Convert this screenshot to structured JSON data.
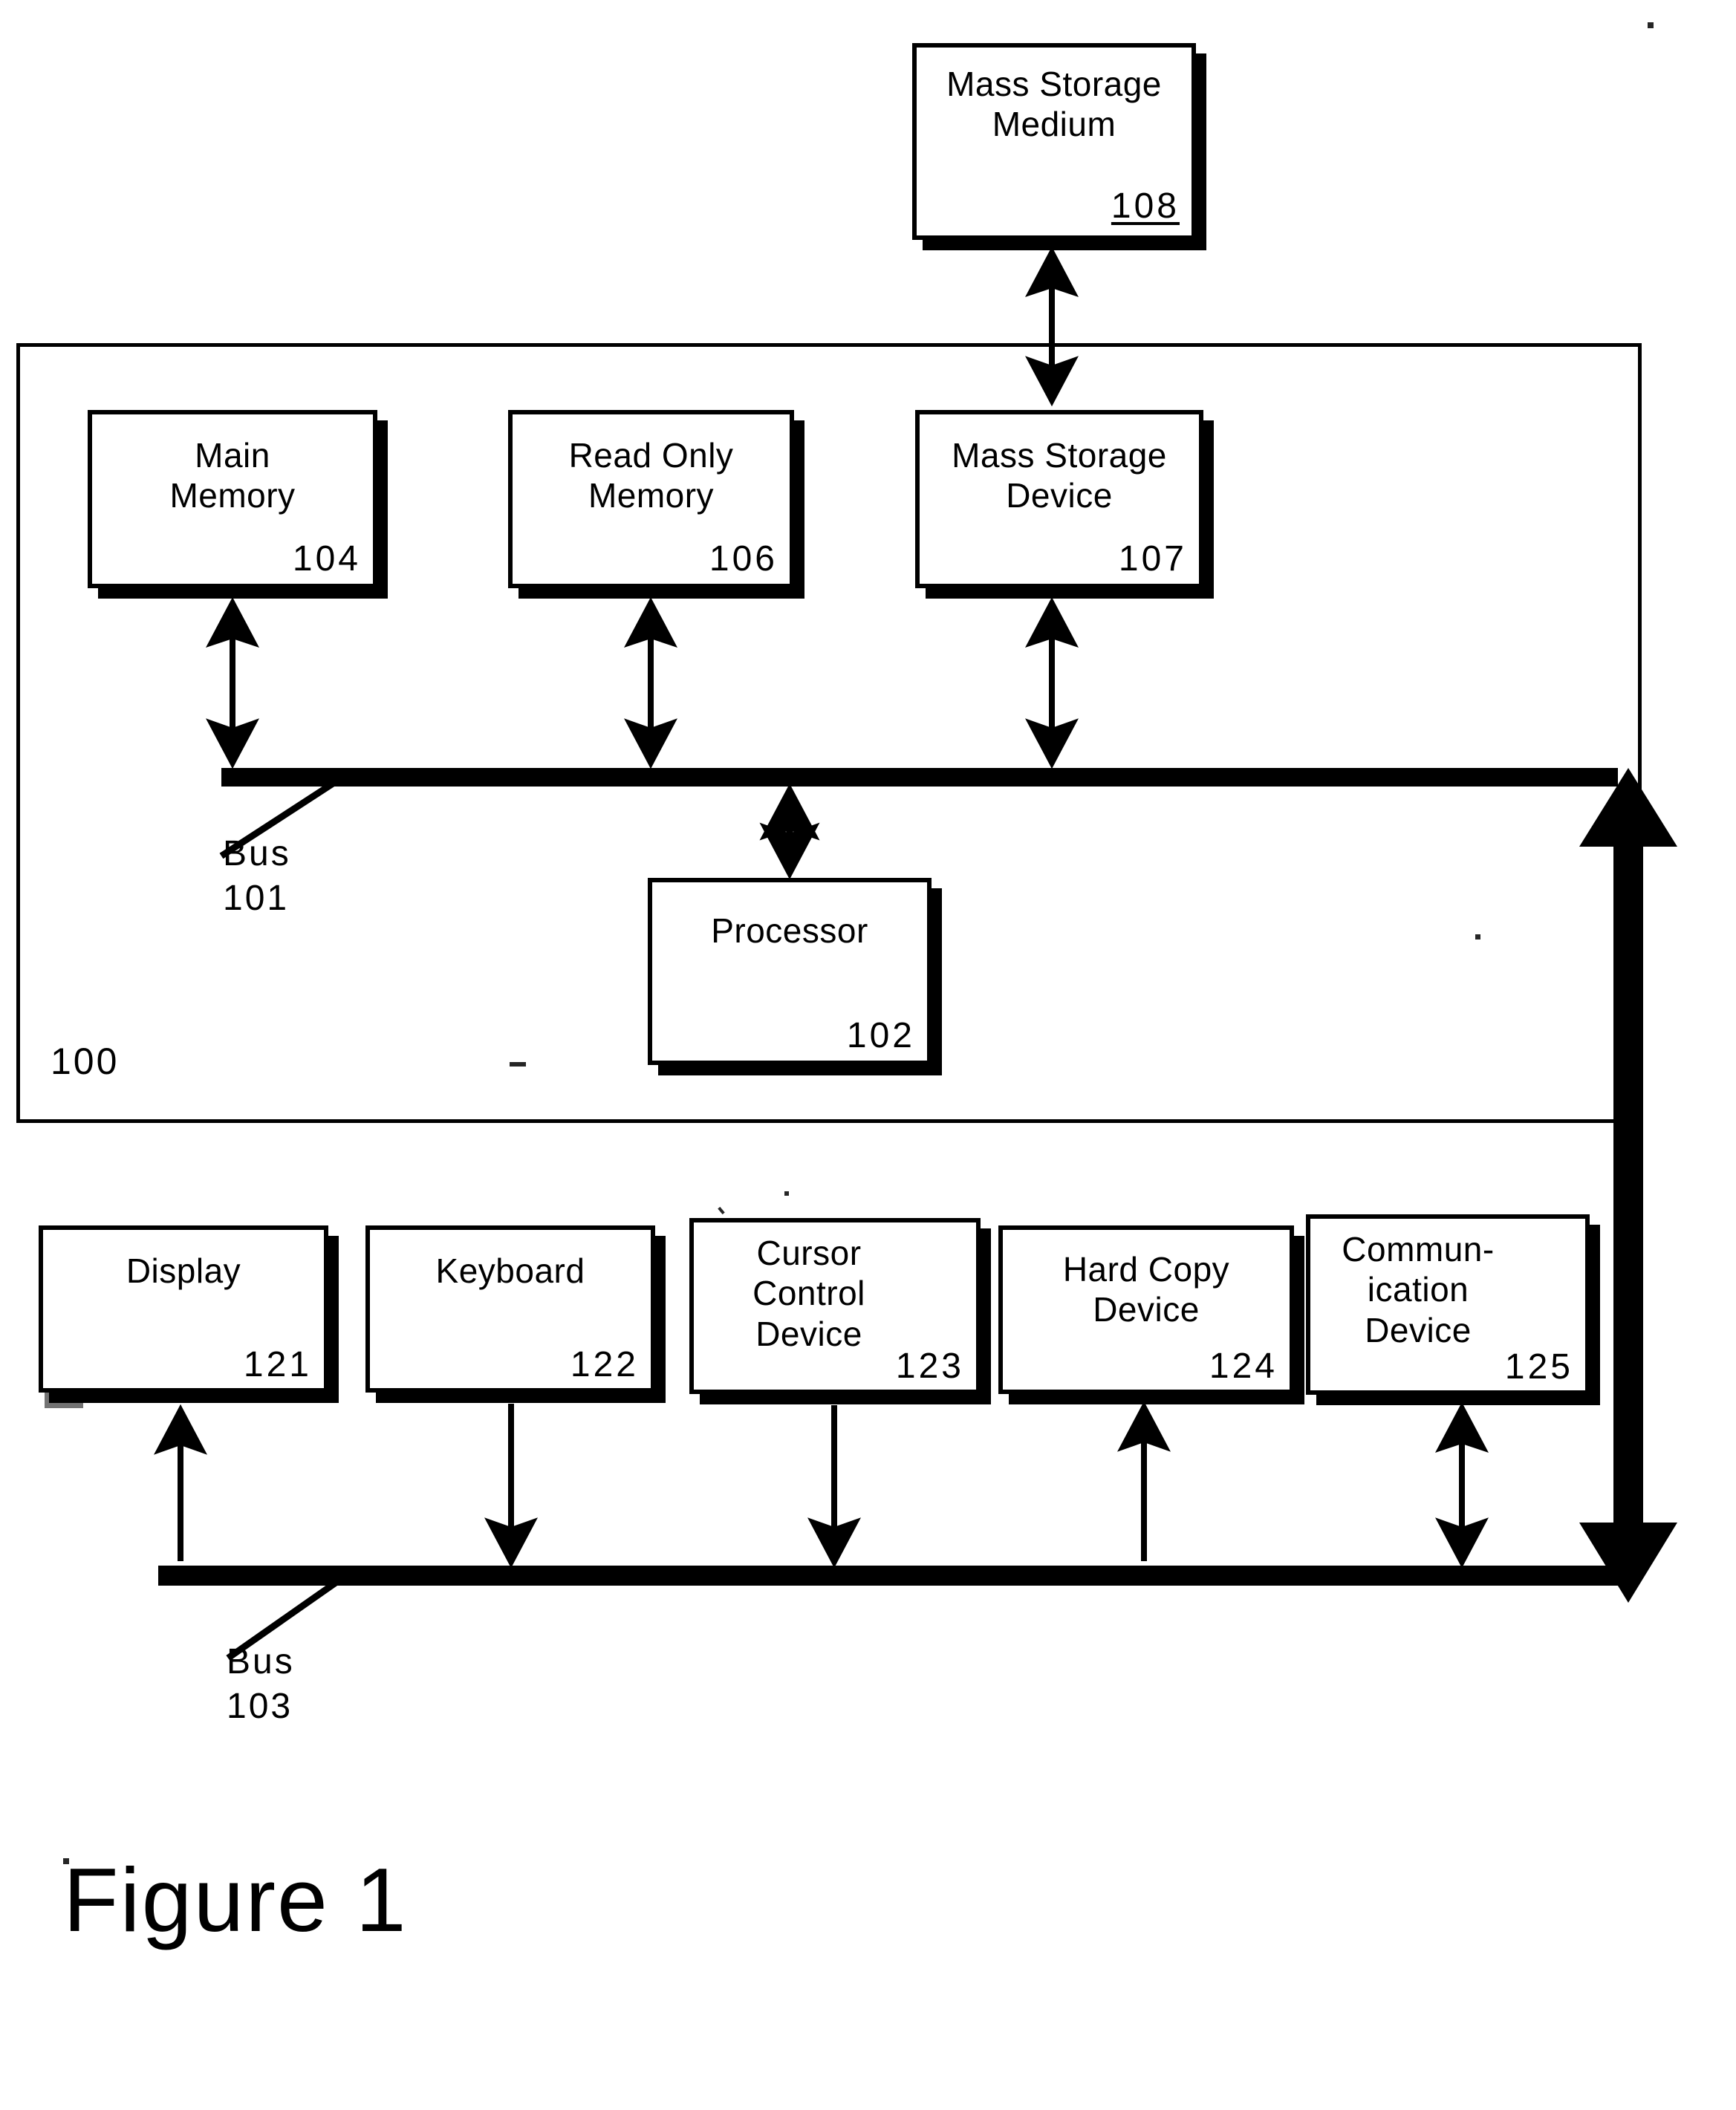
{
  "figure": {
    "caption": "Figure 1"
  },
  "system": {
    "label": "100",
    "name": "computer system boundary"
  },
  "external_blocks": [
    {
      "id": "mass-storage-medium",
      "title": "Mass Storage\nMedium",
      "number": "108",
      "number_underlined": true
    }
  ],
  "internal_blocks": [
    {
      "id": "main-memory",
      "title": "Main\nMemory",
      "number": "104",
      "number_underlined": false
    },
    {
      "id": "read-only-memory",
      "title": "Read Only\nMemory",
      "number": "106",
      "number_underlined": false
    },
    {
      "id": "mass-storage-device",
      "title": "Mass Storage\nDevice",
      "number": "107",
      "number_underlined": false
    },
    {
      "id": "processor",
      "title": "Processor",
      "number": "102",
      "number_underlined": false
    }
  ],
  "peripheral_blocks": [
    {
      "id": "display",
      "title": "Display",
      "number": "121",
      "number_underlined": false
    },
    {
      "id": "keyboard",
      "title": "Keyboard",
      "number": "122",
      "number_underlined": false
    },
    {
      "id": "cursor-control-device",
      "title": "Cursor\nControl\nDevice",
      "number": "123",
      "number_underlined": false
    },
    {
      "id": "hard-copy-device",
      "title": "Hard Copy\nDevice",
      "number": "124",
      "number_underlined": false
    },
    {
      "id": "communication-device",
      "title": "Commun-\nication\nDevice",
      "number": "125",
      "number_underlined": false
    }
  ],
  "buses": [
    {
      "id": "bus-101",
      "label": "Bus\n101",
      "name": "Bus",
      "number": "101"
    },
    {
      "id": "bus-103",
      "label": "Bus\n103",
      "name": "Bus",
      "number": "103"
    }
  ],
  "connections": [
    {
      "from": "mass-storage-medium",
      "to": "mass-storage-device",
      "style": "double-arrow"
    },
    {
      "from": "main-memory",
      "to": "bus-101",
      "style": "double-arrow"
    },
    {
      "from": "read-only-memory",
      "to": "bus-101",
      "style": "double-arrow"
    },
    {
      "from": "mass-storage-device",
      "to": "bus-101",
      "style": "double-arrow"
    },
    {
      "from": "bus-101",
      "to": "processor",
      "style": "double-arrow"
    },
    {
      "from": "bus-103",
      "to": "display",
      "style": "single-arrow-up"
    },
    {
      "from": "keyboard",
      "to": "bus-103",
      "style": "single-arrow-down"
    },
    {
      "from": "cursor-control-device",
      "to": "bus-103",
      "style": "single-arrow-down"
    },
    {
      "from": "bus-103",
      "to": "hard-copy-device",
      "style": "single-arrow-up"
    },
    {
      "from": "communication-device",
      "to": "bus-103",
      "style": "double-arrow"
    },
    {
      "from": "bus-101",
      "to": "bus-103",
      "style": "thick-double-arrow"
    }
  ],
  "colors": {
    "ink": "#000000",
    "paper": "#ffffff"
  }
}
